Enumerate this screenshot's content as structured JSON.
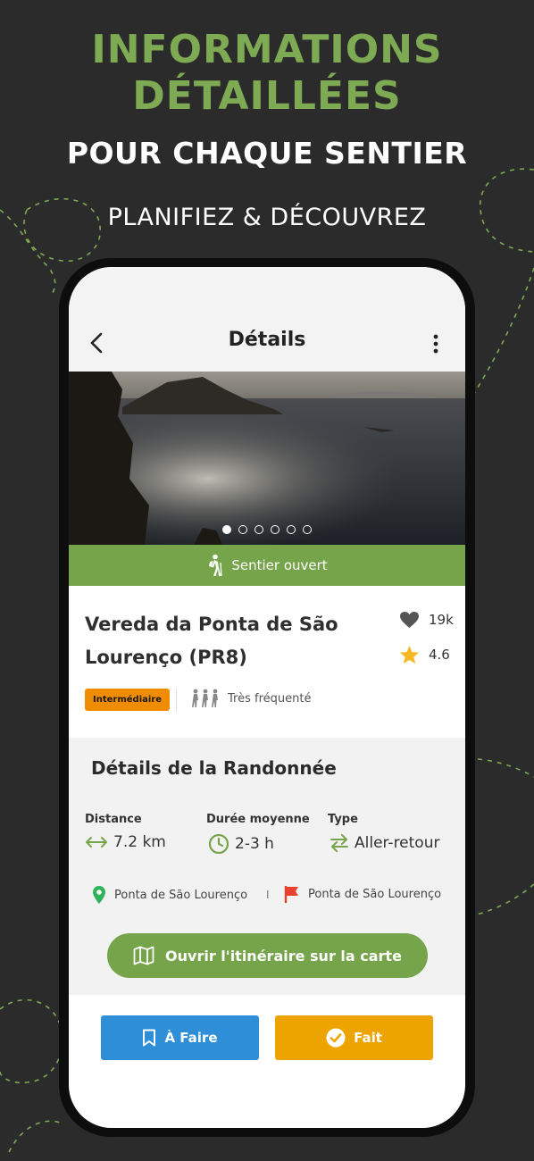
{
  "promo": {
    "title_line1": "INFORMATIONS",
    "title_line2": "DÉTAILLÉES",
    "subtitle": "POUR CHAQUE SENTIER",
    "tagline": "PLANIFIEZ & DÉCOUVREZ"
  },
  "colors": {
    "background": "#2b2b2b",
    "accent_green": "#76a44a",
    "badge_orange": "#f08c00",
    "todo_blue": "#2e8fd8",
    "done_amber": "#eda300",
    "start_marker": "#2fb35a",
    "end_flag": "#e8412f",
    "star": "#f6b824"
  },
  "header": {
    "title": "Détails",
    "back_icon": "chevron-left-icon",
    "menu_icon": "more-vertical-icon"
  },
  "gallery": {
    "image": "coastal-cliffs-sunset-photo",
    "page_count": 6,
    "active_index": 0
  },
  "status": {
    "icon": "hiker-icon",
    "label": "Sentier ouvert"
  },
  "trail": {
    "name": "Vereda da Ponta de São Lourenço (PR8)",
    "likes": "19k",
    "rating": "4.6",
    "difficulty": "Intermédiaire",
    "crowd": "Très fréquenté"
  },
  "details": {
    "title": "Détails de la Randonnée",
    "distance_label": "Distance",
    "distance_value": "7.2 km",
    "duration_label": "Durée moyenne",
    "duration_value": "2-3 h",
    "type_label": "Type",
    "type_value": "Aller-retour",
    "start": "Ponta de São Lourenço",
    "separator": "I",
    "end": "Ponta de São Lourenço",
    "map_button": "Ouvrir l'itinéraire sur la carte"
  },
  "actions": {
    "todo_label": "À Faire",
    "done_label": "Fait"
  }
}
